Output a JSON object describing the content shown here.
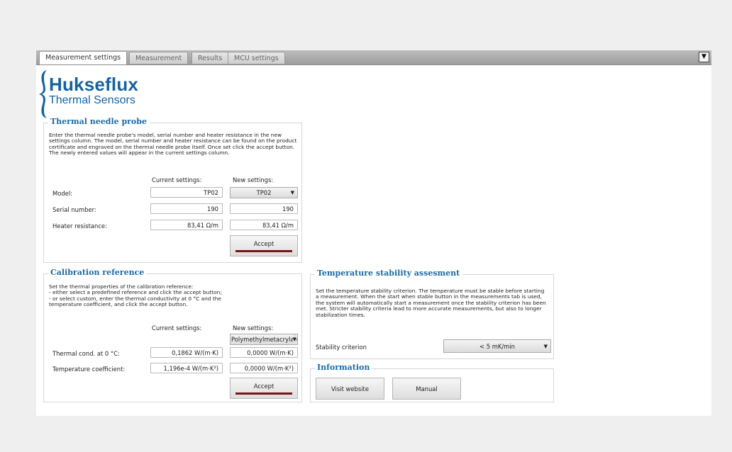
{
  "tabs": [
    {
      "label": "Measurement settings"
    },
    {
      "label": "Measurement"
    },
    {
      "label": "Results"
    },
    {
      "label": "MCU settings"
    }
  ],
  "menu_icon": "triangle-down-icon",
  "logo": {
    "brand": "Hukseflux",
    "subtitle": "Thermal Sensors",
    "color": "#15639f"
  },
  "needle": {
    "title": "Thermal needle probe",
    "description": "Enter the thermal needle probe's model, serial number and heater resistance in the new settings column. The model, serial number and heater resistance can be found on the product certificate and engraved on the thermal needle probe itself. Once set click the accept button. The newly entered values will appear in the current settings column.",
    "current_header": "Current settings:",
    "new_header": "New settings:",
    "rows": [
      {
        "label": "Model:",
        "current": "TP02",
        "new": "TP02"
      },
      {
        "label": "Serial number:",
        "current": "190",
        "new": "190"
      },
      {
        "label": "Heater resistance:",
        "current": "83,41 Ω/m",
        "new": "83,41 Ω/m"
      }
    ],
    "accept_label": "Accept"
  },
  "calibration": {
    "title": "Calibration reference",
    "description_lines": [
      "Set the thermal properties of the calibration reference:",
      "- either select a predefined reference and click the accept button;",
      "- or select custom, enter the thermal conductivity at 0 °C and the",
      "temperature coefficient, and click the accept button."
    ],
    "current_header": "Current settings:",
    "new_header": "New settings:",
    "reference_select": "Polymethylmetacrylate",
    "rows": [
      {
        "label": "Thermal cond. at 0 °C:",
        "current": "0,1862 W/(m·K)",
        "new": "0,0000 W/(m·K)"
      },
      {
        "label": "Temperature coefficient:",
        "current": "1,196e-4 W/(m·K²)",
        "new": "0,0000 W/(m·K²)"
      }
    ],
    "accept_label": "Accept"
  },
  "stability": {
    "title": "Temperature stability assesment",
    "description": "Set the temperature stability criterion. The temperature must be stable before starting a measurement. When the start when stable button in the measurements tab is used, the system will automatically start a measurement once the stability criterion has been met. Stricter stability criteria lead to more accurate measurements, but also to longer stabilization times.",
    "criterion_label": "Stability criterion",
    "criterion_value": "< 5 mK/min"
  },
  "information": {
    "title": "Information",
    "visit_label": "Visit website",
    "manual_label": "Manual"
  },
  "colors": {
    "accent": "#1b6aa6",
    "accept_bar": "#7a1414"
  }
}
